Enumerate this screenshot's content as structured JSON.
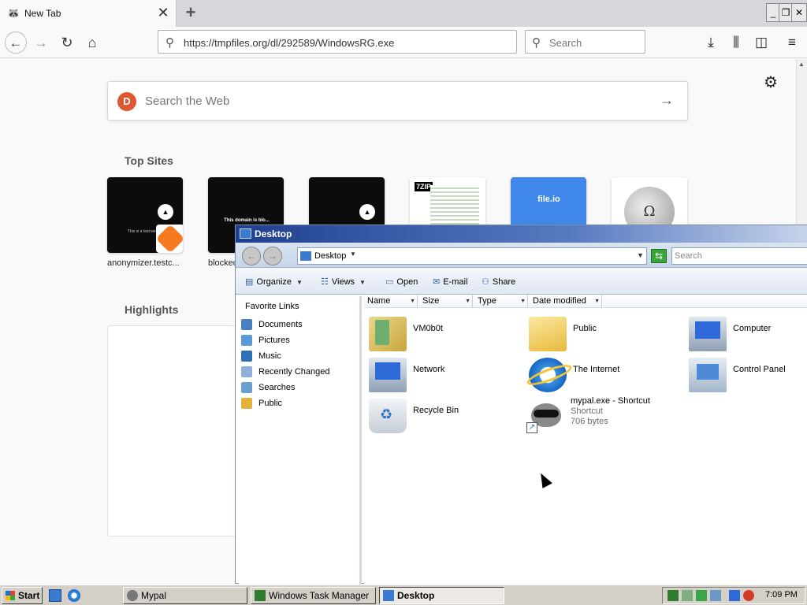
{
  "browser": {
    "tab": {
      "title": "New Tab"
    },
    "url": "https://tmpfiles.org/dl/292589/WindowsRG.exe",
    "search_placeholder": "Search"
  },
  "newtab": {
    "web_search_placeholder": "Search the Web",
    "top_sites_title": "Top Sites",
    "highlights_title": "Highlights",
    "top_sites": [
      {
        "label": "anonymizer.testc..."
      },
      {
        "label": "blocked"
      },
      {
        "label": ""
      },
      {
        "label": ""
      },
      {
        "label": ""
      },
      {
        "label": ""
      }
    ],
    "thumb_text": {
      "anonymizer": "This is a test website",
      "blocked": "This domain is blo...",
      "fileio": "file.io",
      "zip": "7ZIP",
      "wiki": "Ω"
    }
  },
  "explorer": {
    "title": "Desktop",
    "path": "Desktop",
    "search_placeholder": "Search",
    "toolbar": {
      "organize": "Organize",
      "views": "Views",
      "open": "Open",
      "email": "E-mail",
      "share": "Share"
    },
    "nav_head": "Favorite Links",
    "nav_links": [
      {
        "label": "Documents",
        "color": "#4a7ec2"
      },
      {
        "label": "Pictures",
        "color": "#5c9ad6"
      },
      {
        "label": "Music",
        "color": "#2f6fb5"
      },
      {
        "label": "Recently Changed",
        "color": "#8fb0d8"
      },
      {
        "label": "Searches",
        "color": "#6b9fce"
      },
      {
        "label": "Public",
        "color": "#e3b33c"
      }
    ],
    "columns": [
      "Name",
      "Size",
      "Type",
      "Date modified"
    ],
    "items": [
      {
        "name": "VM0b0t",
        "icon": "folder-icon"
      },
      {
        "name": "Public",
        "icon": "folder-icon"
      },
      {
        "name": "Computer",
        "icon": "computer-icon"
      },
      {
        "name": "Network",
        "icon": "network-icon"
      },
      {
        "name": "The Internet",
        "icon": "internet-explorer-icon"
      },
      {
        "name": "Control Panel",
        "icon": "control-panel-icon"
      },
      {
        "name": "Recycle Bin",
        "icon": "recycle-bin-icon"
      },
      {
        "name": "mypal.exe - Shortcut",
        "subtitle": "Shortcut",
        "size": "706 bytes",
        "icon": "mypal-shortcut-icon"
      }
    ]
  },
  "taskbar": {
    "start": "Start",
    "tasks": [
      "Mypal",
      "Windows Task Manager",
      "Desktop"
    ],
    "clock": "7:09 PM"
  }
}
